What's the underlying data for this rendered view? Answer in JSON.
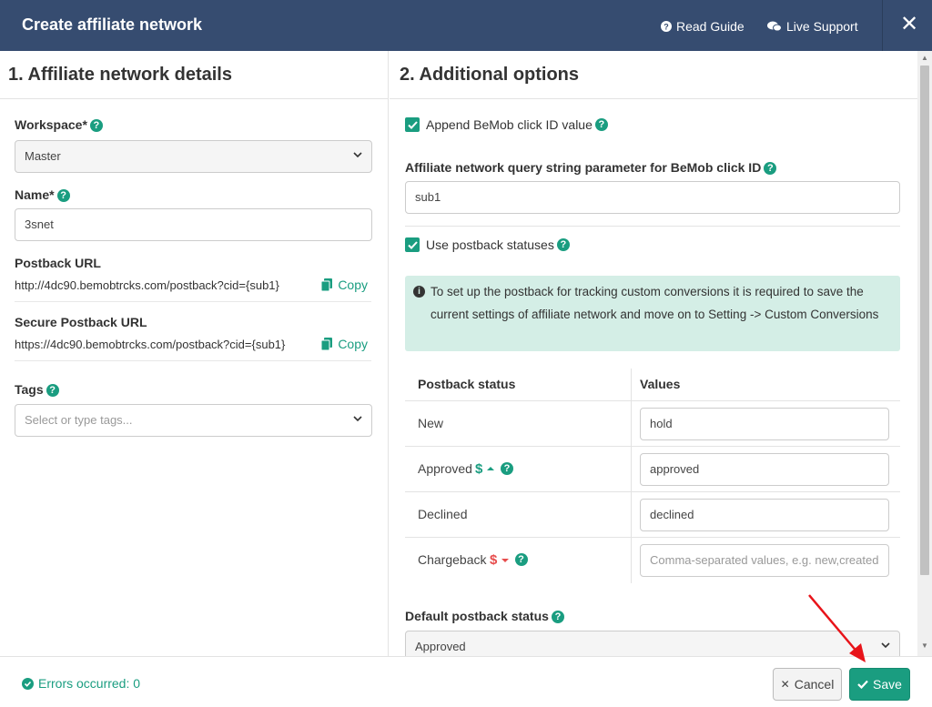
{
  "header": {
    "title": "Create affiliate network",
    "read_guide": "Read Guide",
    "live_support": "Live Support",
    "close": "✕"
  },
  "left": {
    "section_title": "1. Affiliate network details",
    "workspace_label": "Workspace*",
    "workspace_value": "Master",
    "name_label": "Name*",
    "name_value": "3snet",
    "postback_label": "Postback URL",
    "postback_url": "http://4dc90.bemobtrcks.com/postback?cid={sub1}",
    "secure_postback_label": "Secure Postback URL",
    "secure_postback_url": "https://4dc90.bemobtrcks.com/postback?cid={sub1}",
    "copy_label": "Copy",
    "tags_label": "Tags",
    "tags_placeholder": "Select or type tags..."
  },
  "right": {
    "section_title": "2. Additional options",
    "append_click_id_label": "Append BeMob click ID value",
    "append_click_id_checked": true,
    "query_param_label": "Affiliate network query string parameter for BeMob click ID",
    "query_param_value": "sub1",
    "use_postback_statuses_label": "Use postback statuses",
    "use_postback_statuses_checked": true,
    "info_text": "To set up the postback for tracking custom conversions it is required to save the current settings of affiliate network and move on to Setting -> Custom Conversions",
    "table_headers": {
      "status": "Postback status",
      "values": "Values"
    },
    "rows": [
      {
        "status": "New",
        "value": "hold"
      },
      {
        "status": "Approved",
        "value": "approved"
      },
      {
        "status": "Declined",
        "value": "declined"
      },
      {
        "status": "Chargeback",
        "value": "",
        "placeholder": "Comma-separated values, e.g. new,created"
      }
    ],
    "default_status_label": "Default postback status",
    "default_status_value": "Approved"
  },
  "footer": {
    "errors_text": "Errors occurred: 0",
    "cancel_label": "Cancel",
    "save_label": "Save"
  },
  "colors": {
    "header_bg": "#364c70",
    "accent": "#1a9d80",
    "info_bg": "#d4eee6",
    "danger": "#e74c4c",
    "annotation_arrow": "#e8141a"
  }
}
